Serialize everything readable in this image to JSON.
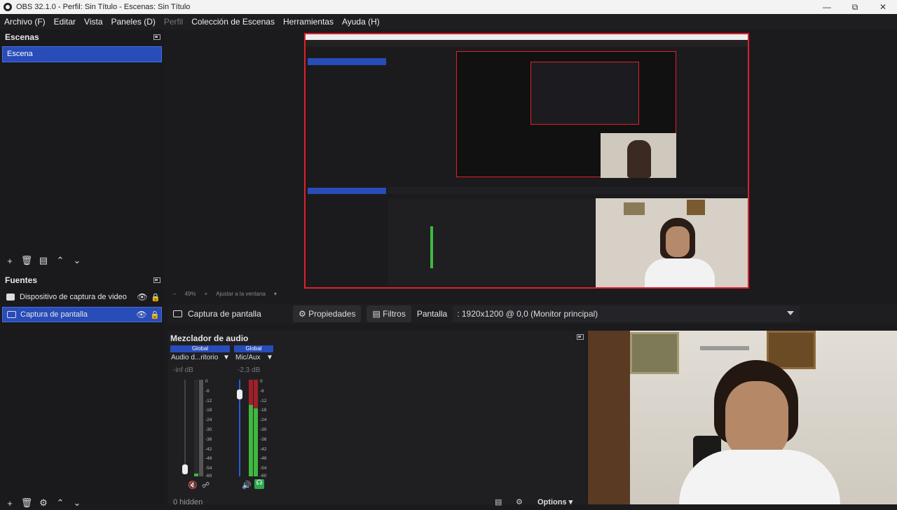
{
  "titlebar": {
    "title": "OBS 32.1.0 - Perfil: Sin Título - Escenas: Sin Título"
  },
  "menu": [
    {
      "label": "Archivo (F)",
      "disabled": false
    },
    {
      "label": "Editar",
      "disabled": false
    },
    {
      "label": "Vista",
      "disabled": false
    },
    {
      "label": "Paneles (D)",
      "disabled": false
    },
    {
      "label": "Perfil",
      "disabled": true
    },
    {
      "label": "Colección de Escenas",
      "disabled": false
    },
    {
      "label": "Herramientas",
      "disabled": false
    },
    {
      "label": "Ayuda (H)",
      "disabled": false
    }
  ],
  "scenes": {
    "title": "Escenas",
    "items": [
      "Escena"
    ]
  },
  "sources": {
    "title": "Fuentes",
    "items": [
      {
        "label": "Dispositivo de captura de video",
        "icon": "camera-icon",
        "selected": false
      },
      {
        "label": "Captura de pantalla",
        "icon": "monitor-icon",
        "selected": true
      }
    ]
  },
  "preview": {
    "zoom": "49%",
    "fit_label": "Ajustar a la ventana"
  },
  "context": {
    "source_name": "Captura de pantalla",
    "properties_label": "Propiedades",
    "filters_label": "Filtros",
    "display_label": "Pantalla",
    "display_value": ": 1920x1200 @ 0,0 (Monitor principal)"
  },
  "mixer": {
    "title": "Mezclador de audio",
    "channels": [
      {
        "header": "Global",
        "name": "Audio d...ritorio",
        "db": "-inf dB",
        "level": 0.04,
        "muted": true
      },
      {
        "header": "Global",
        "name": "Mic/Aux",
        "db": "-2.3 dB",
        "level": 0.95,
        "muted": false
      }
    ],
    "scale": [
      "0",
      "-6",
      "-12",
      "-18",
      "-24",
      "-30",
      "-36",
      "-42",
      "-48",
      "-54",
      "-60"
    ],
    "hidden_label": "0 hidden",
    "options_label": "Options"
  },
  "colors": {
    "accent": "#284cb8",
    "preview_border": "#e0202a",
    "meter_green": "#3fb83f",
    "meter_red": "#a0202a"
  }
}
